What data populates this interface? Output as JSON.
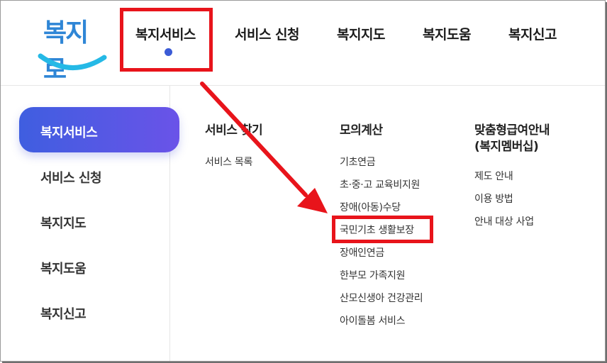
{
  "logo": {
    "text": "복지로"
  },
  "nav": {
    "items": [
      {
        "label": "복지서비스"
      },
      {
        "label": "서비스 신청"
      },
      {
        "label": "복지지도"
      },
      {
        "label": "복지도움"
      },
      {
        "label": "복지신고"
      }
    ]
  },
  "sidebar": {
    "items": [
      {
        "label": "복지서비스"
      },
      {
        "label": "서비스 신청"
      },
      {
        "label": "복지지도"
      },
      {
        "label": "복지도움"
      },
      {
        "label": "복지신고"
      }
    ]
  },
  "columns": [
    {
      "title": "서비스 찾기",
      "links": [
        "서비스 목록"
      ]
    },
    {
      "title": "모의계산",
      "links": [
        "기초연금",
        "초·중·고 교육비지원",
        "장애(아동)수당",
        "국민기초 생활보장",
        "장애인연금",
        "한부모 가족지원",
        "산모신생아 건강관리",
        "아이돌봄 서비스"
      ]
    },
    {
      "title_lines": [
        "맞춤형급여안내",
        "(복지멤버십)"
      ],
      "links": [
        "제도 안내",
        "이용 방법",
        "안내 대상 사업"
      ]
    }
  ],
  "colors": {
    "accent": "#3b5bd6",
    "highlight": "#e8141b",
    "logo_blue": "#2f86d6",
    "logo_cyan": "#25b9e6"
  }
}
